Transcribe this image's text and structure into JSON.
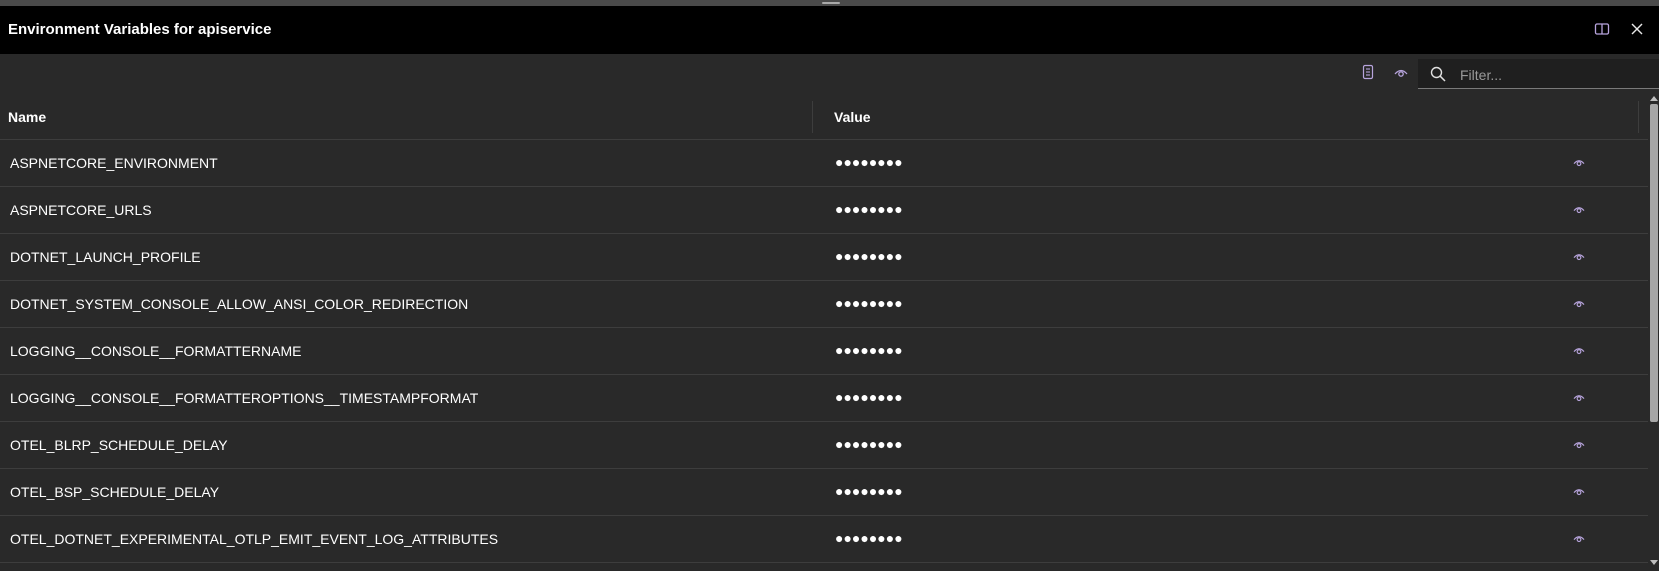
{
  "window": {
    "title": "Environment Variables for apiservice",
    "split_icon": "split-view-icon",
    "close_icon": "close-icon"
  },
  "toolbar": {
    "copy_icon": "document-icon",
    "show_values_icon": "eye-icon",
    "filter": {
      "placeholder": "Filter...",
      "value": "",
      "icon": "search-icon"
    }
  },
  "columns": {
    "name": "Name",
    "value": "Value"
  },
  "rows": [
    {
      "name": "ASPNETCORE_ENVIRONMENT",
      "value": "●●●●●●●●"
    },
    {
      "name": "ASPNETCORE_URLS",
      "value": "●●●●●●●●"
    },
    {
      "name": "DOTNET_LAUNCH_PROFILE",
      "value": "●●●●●●●●"
    },
    {
      "name": "DOTNET_SYSTEM_CONSOLE_ALLOW_ANSI_COLOR_REDIRECTION",
      "value": "●●●●●●●●"
    },
    {
      "name": "LOGGING__CONSOLE__FORMATTERNAME",
      "value": "●●●●●●●●"
    },
    {
      "name": "LOGGING__CONSOLE__FORMATTEROPTIONS__TIMESTAMPFORMAT",
      "value": "●●●●●●●●"
    },
    {
      "name": "OTEL_BLRP_SCHEDULE_DELAY",
      "value": "●●●●●●●●"
    },
    {
      "name": "OTEL_BSP_SCHEDULE_DELAY",
      "value": "●●●●●●●●"
    },
    {
      "name": "OTEL_DOTNET_EXPERIMENTAL_OTLP_EMIT_EVENT_LOG_ATTRIBUTES",
      "value": "●●●●●●●●"
    }
  ],
  "colors": {
    "background": "#292929",
    "titlebar": "#000000",
    "accent_eye": "#b7a4dc",
    "border": "#3d3d3d"
  }
}
